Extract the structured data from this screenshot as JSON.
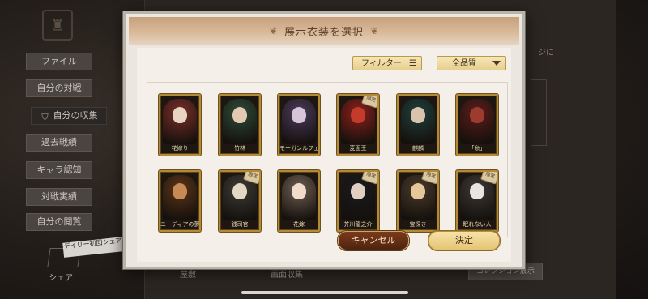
{
  "background": {
    "sidebar": [
      {
        "label": "ファイル",
        "active": false
      },
      {
        "label": "自分の対戦",
        "active": false
      },
      {
        "label": "自分の収集",
        "active": true
      },
      {
        "label": "過去戦績",
        "active": false
      },
      {
        "label": "キャラ認知",
        "active": false
      },
      {
        "label": "対戦実績",
        "active": false
      },
      {
        "label": "自分の閲覧",
        "active": false
      }
    ],
    "daily_share": "デイリー初回シェア",
    "share": "シェア",
    "bottom_tab_left": "屋敷",
    "bottom_tab_mid": "画面収集",
    "bottom_right_button": "コレクション展示",
    "edge_text": "ジに"
  },
  "dialog": {
    "title": "展示衣装を選択",
    "filter_label": "フィルター",
    "filter_icon": "list-filter-icon",
    "quality_label": "全品質",
    "quality_icon": "chevron-down-icon",
    "cancel_label": "キャンセル",
    "confirm_label": "決定",
    "limited_badge": "限定",
    "costumes": [
      {
        "name": "花嫁り",
        "limited": false,
        "art": "#7a2f2a",
        "head": "#e8d4c2"
      },
      {
        "name": "竹林",
        "limited": false,
        "art": "#2f4a38",
        "head": "#e3c9b2"
      },
      {
        "name": "モーガンルフェ",
        "limited": false,
        "art": "#4b3a5a",
        "head": "#d6c4d8"
      },
      {
        "name": "変面王",
        "limited": true,
        "art": "#8c1f1c",
        "head": "#c23b2b"
      },
      {
        "name": "麒麟",
        "limited": false,
        "art": "#1f3f3c",
        "head": "#d9c3ad"
      },
      {
        "name": "「糸」",
        "limited": false,
        "art": "#5a1d1a",
        "head": "#9c3b2e"
      },
      {
        "name": "ニーディアの夢",
        "limited": false,
        "art": "#5a3418",
        "head": "#c88a55"
      },
      {
        "name": "銭司官",
        "limited": true,
        "art": "#3e3a34",
        "head": "#e2d8c4"
      },
      {
        "name": "花嫁",
        "limited": false,
        "art": "#6e5e52",
        "head": "#f0dcc8"
      },
      {
        "name": "芥川龍之介",
        "limited": true,
        "art": "#1a1a1e",
        "head": "#e0cfc0"
      },
      {
        "name": "宝探さ",
        "limited": true,
        "art": "#4a3a2a",
        "head": "#e6c898"
      },
      {
        "name": "眠れない人",
        "limited": true,
        "art": "#3c3836",
        "head": "#e9e4df"
      }
    ]
  },
  "colors": {
    "card_border": "#b48a36",
    "cancel_bg": "#5a2a14",
    "confirm_bg": "#eed08a",
    "dialog_bg": "#ece7de"
  }
}
